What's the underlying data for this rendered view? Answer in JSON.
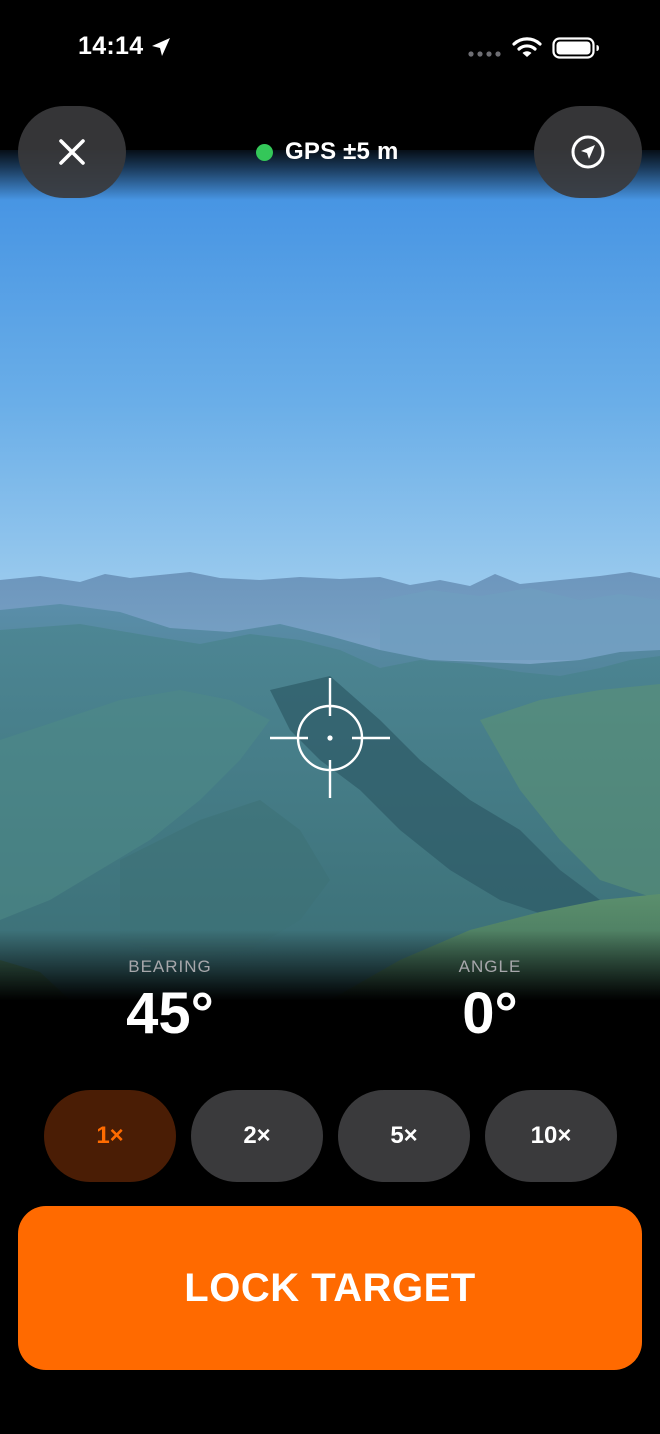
{
  "status_bar": {
    "time": "14:14",
    "icons": [
      "location-arrow-icon",
      "cellular-signal-icon",
      "wifi-icon",
      "battery-icon"
    ]
  },
  "header": {
    "close_icon": "close-icon",
    "locate_icon": "navigation-arrow-icon",
    "gps_label": "GPS ±5 m",
    "gps_status_color": "#34c759"
  },
  "viewfinder": {
    "reticle_icon": "crosshair-icon"
  },
  "readouts": {
    "bearing": {
      "label": "BEARING",
      "value": "45°"
    },
    "angle": {
      "label": "ANGLE",
      "value": "0°"
    }
  },
  "zoom": {
    "options": [
      "1×",
      "2×",
      "5×",
      "10×"
    ],
    "selected": "1×"
  },
  "action": {
    "lock_label": "LOCK TARGET",
    "accent_color": "#ff6a00"
  }
}
